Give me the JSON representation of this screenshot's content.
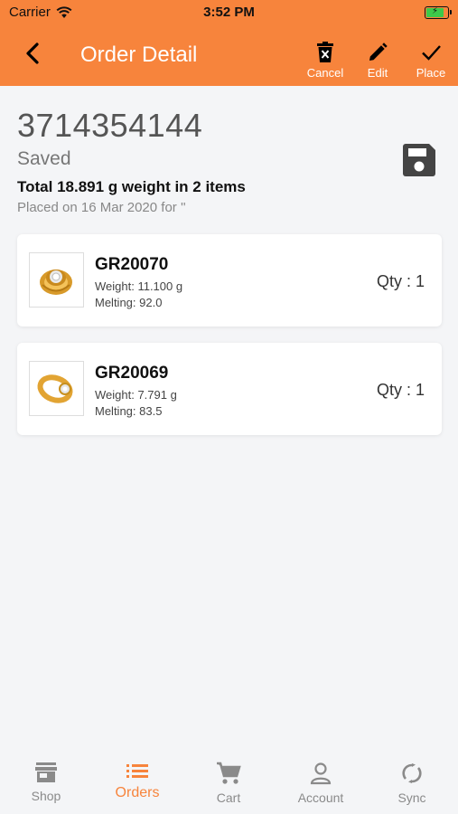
{
  "status_bar": {
    "carrier": "Carrier",
    "time": "3:52 PM"
  },
  "nav": {
    "title": "Order Detail",
    "actions": [
      {
        "label": "Cancel",
        "icon": "delete-icon"
      },
      {
        "label": "Edit",
        "icon": "pencil-icon"
      },
      {
        "label": "Place",
        "icon": "check-icon"
      }
    ]
  },
  "order": {
    "number": "3714354144",
    "status": "Saved",
    "total": "Total 18.891 g weight in 2 items",
    "placed": "Placed on 16 Mar 2020 for ''"
  },
  "items": [
    {
      "code": "GR20070",
      "weight": "Weight: 11.100 g",
      "melting": "Melting: 92.0",
      "qty": "Qty : 1"
    },
    {
      "code": "GR20069",
      "weight": "Weight: 7.791 g",
      "melting": "Melting: 83.5",
      "qty": "Qty : 1"
    }
  ],
  "tabs": [
    {
      "label": "Shop",
      "icon": "shop-icon"
    },
    {
      "label": "Orders",
      "icon": "list-icon"
    },
    {
      "label": "Cart",
      "icon": "cart-icon"
    },
    {
      "label": "Account",
      "icon": "person-icon"
    },
    {
      "label": "Sync",
      "icon": "sync-icon"
    }
  ],
  "active_tab": "Orders",
  "colors": {
    "accent": "#f7843c",
    "background": "#f4f5f7",
    "tab_inactive": "#8a8a8a"
  }
}
